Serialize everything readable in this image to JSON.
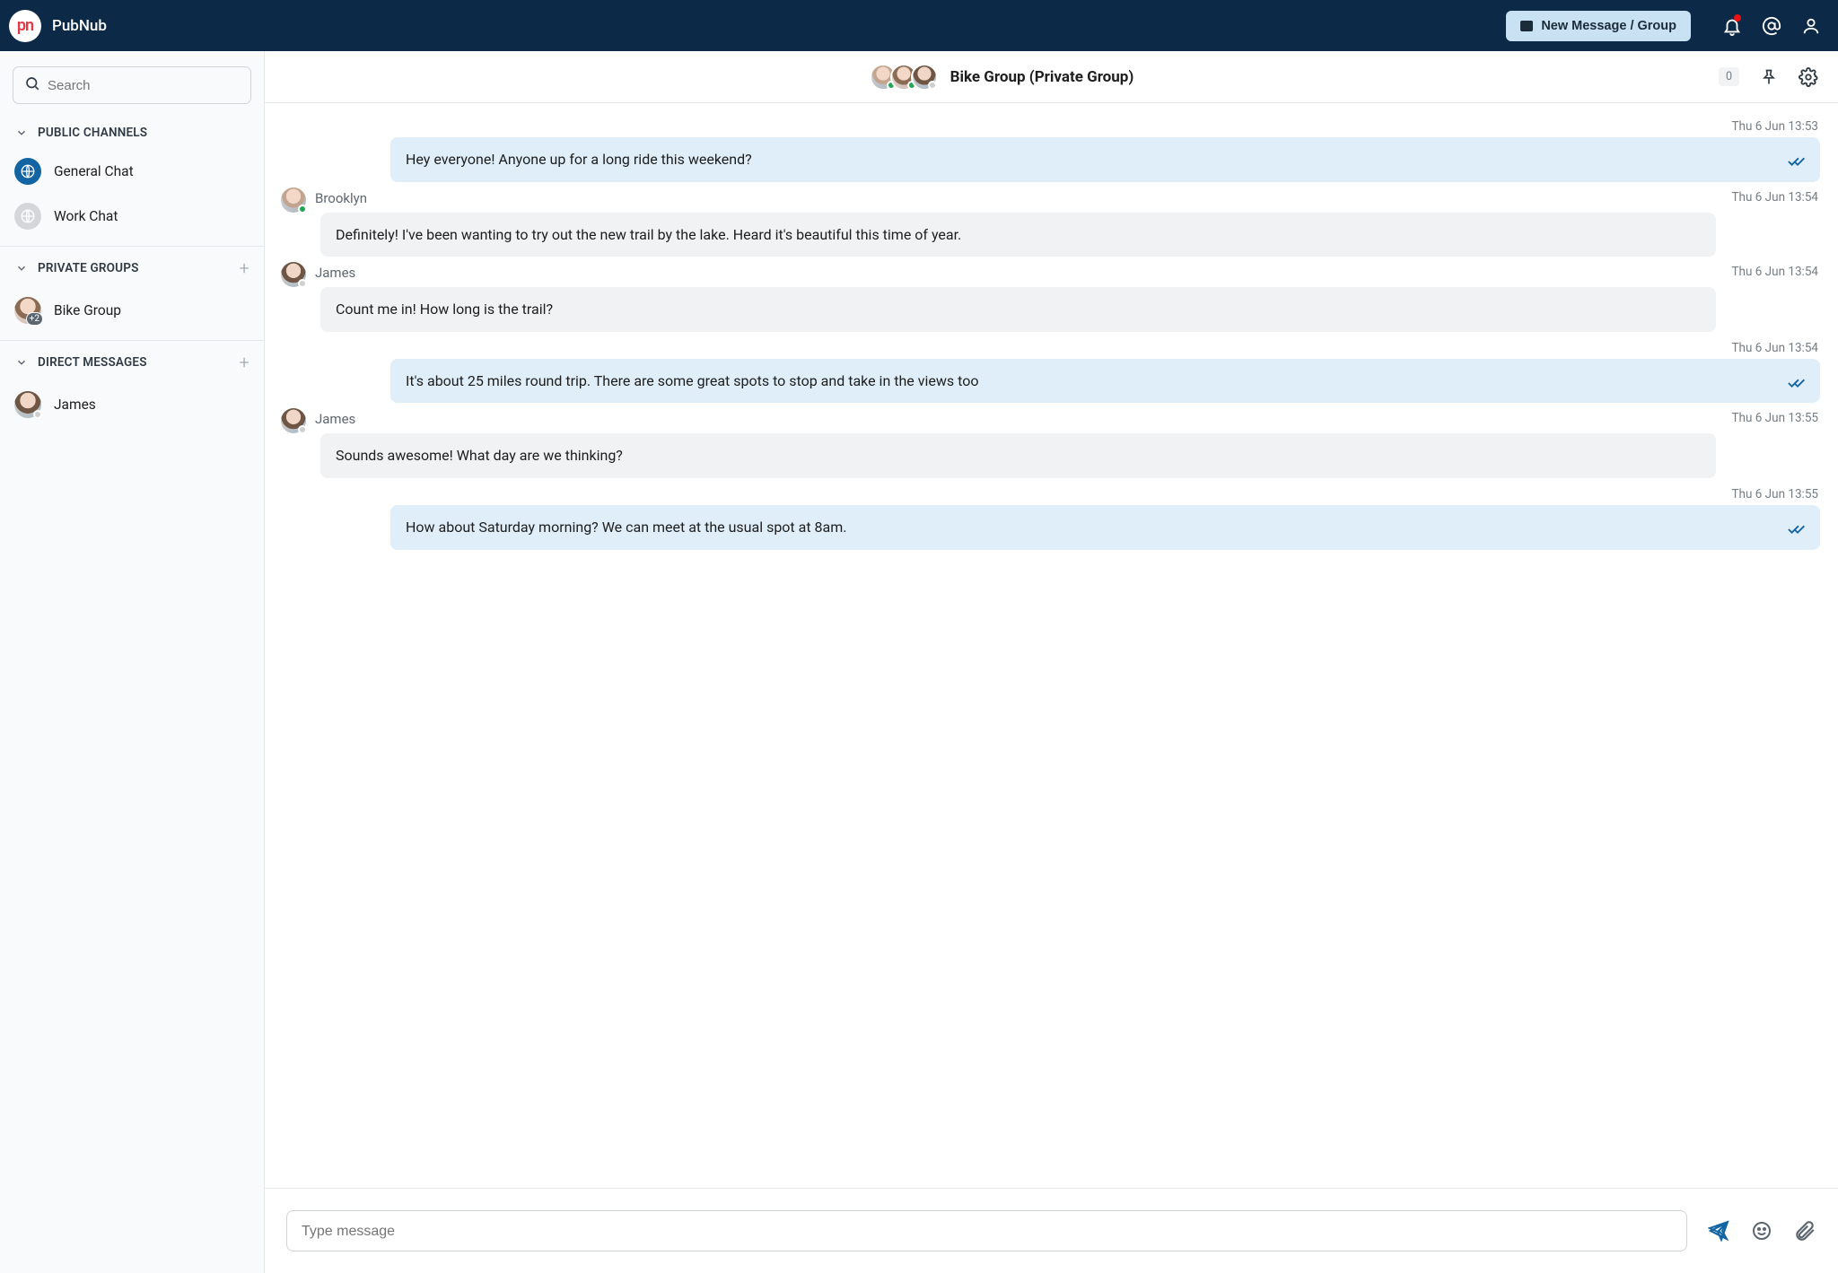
{
  "header": {
    "brand": "PubNub",
    "new_message_label": "New Message / Group"
  },
  "sidebar": {
    "search_placeholder": "Search",
    "sections": {
      "public": {
        "title": "PUBLIC CHANNELS"
      },
      "private": {
        "title": "PRIVATE GROUPS"
      },
      "direct": {
        "title": "DIRECT MESSAGES"
      }
    },
    "public_channels": [
      {
        "label": "General Chat",
        "active": true
      },
      {
        "label": "Work Chat",
        "active": false
      }
    ],
    "private_groups": [
      {
        "label": "Bike Group",
        "extra_count": "+2"
      }
    ],
    "direct_messages": [
      {
        "label": "James",
        "presence": "offline"
      }
    ]
  },
  "chat": {
    "title": "Bike Group (Private Group)",
    "unread_count": "0",
    "messages": [
      {
        "side": "mine",
        "time": "Thu 6 Jun 13:53",
        "text": "Hey everyone! Anyone up for a long ride this weekend?"
      },
      {
        "side": "theirs",
        "author": "Brooklyn",
        "presence": "online",
        "time": "Thu 6 Jun 13:54",
        "text": "Definitely! I've been wanting to try out the new trail by the lake. Heard it's beautiful this time of year."
      },
      {
        "side": "theirs",
        "author": "James",
        "presence": "offline",
        "time": "Thu 6 Jun 13:54",
        "text": "Count me in! How long is the trail?"
      },
      {
        "side": "mine",
        "time": "Thu 6 Jun 13:54",
        "text": "It's about 25 miles round trip. There are some great spots to stop and take in the views too"
      },
      {
        "side": "theirs",
        "author": "James",
        "presence": "offline",
        "time": "Thu 6 Jun 13:55",
        "text": "Sounds awesome! What day are we thinking?"
      },
      {
        "side": "mine",
        "time": "Thu 6 Jun 13:55",
        "text": "How about Saturday morning? We can meet at the usual spot at 8am."
      }
    ]
  },
  "composer": {
    "placeholder": "Type message"
  }
}
